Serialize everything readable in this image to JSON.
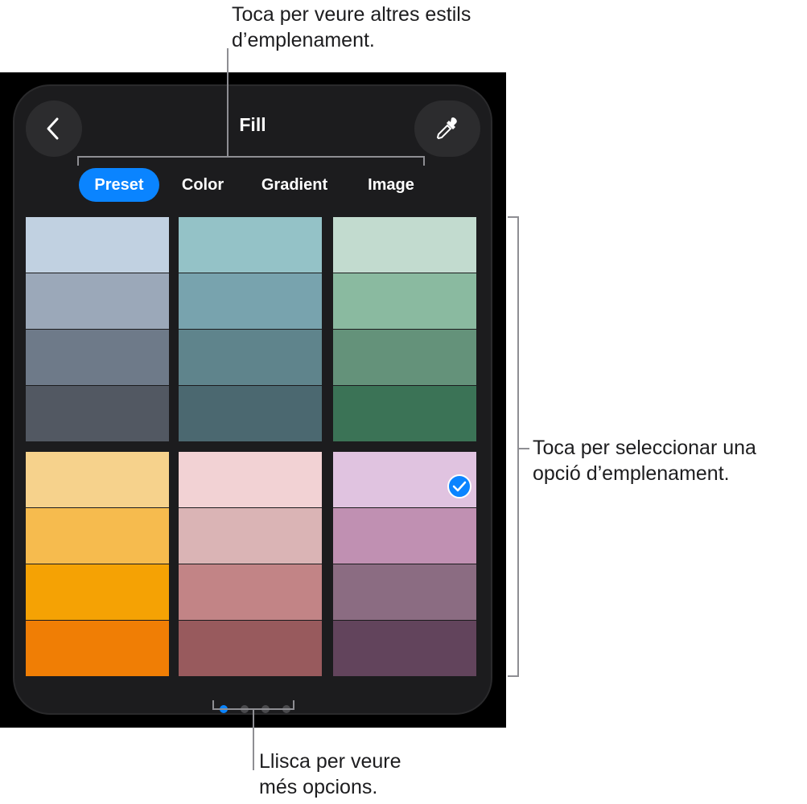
{
  "callouts": {
    "tabs": "Toca per veure altres estils\nd’emplenament.",
    "swatches": "Toca per seleccionar una\nopció d’emplenament.",
    "pages": "Llisca per veure\nmés opcions."
  },
  "panel": {
    "title": "Fill",
    "back_icon": "chevron-left-icon",
    "eyedropper_icon": "eyedropper-icon"
  },
  "tabs": [
    {
      "label": "Preset",
      "selected": true
    },
    {
      "label": "Color",
      "selected": false
    },
    {
      "label": "Gradient",
      "selected": false
    },
    {
      "label": "Image",
      "selected": false
    }
  ],
  "presets": [
    {
      "name": "blue-gray",
      "colors": [
        "#c1d1e1",
        "#9ba8b9",
        "#6e7a89",
        "#525862"
      ],
      "selected": false
    },
    {
      "name": "teal",
      "colors": [
        "#94c2c7",
        "#78a3ae",
        "#5f848c",
        "#4b6870"
      ],
      "selected": false
    },
    {
      "name": "green",
      "colors": [
        "#c2dbcf",
        "#8abaa0",
        "#64927a",
        "#3b7356"
      ],
      "selected": false
    },
    {
      "name": "orange",
      "colors": [
        "#f6d28c",
        "#f6bb4e",
        "#f5a204",
        "#f07e05"
      ],
      "selected": false
    },
    {
      "name": "rose",
      "colors": [
        "#f2d2d4",
        "#dab4b5",
        "#c28486",
        "#985a5d"
      ],
      "selected": false
    },
    {
      "name": "purple",
      "colors": [
        "#e0c3e0",
        "#c090b2",
        "#8b6c82",
        "#62445c"
      ],
      "selected": true
    }
  ],
  "pagination": {
    "total": 4,
    "current": 1
  },
  "colors": {
    "accent": "#0a84ff",
    "inactive_dot": "#4a4a4d"
  }
}
